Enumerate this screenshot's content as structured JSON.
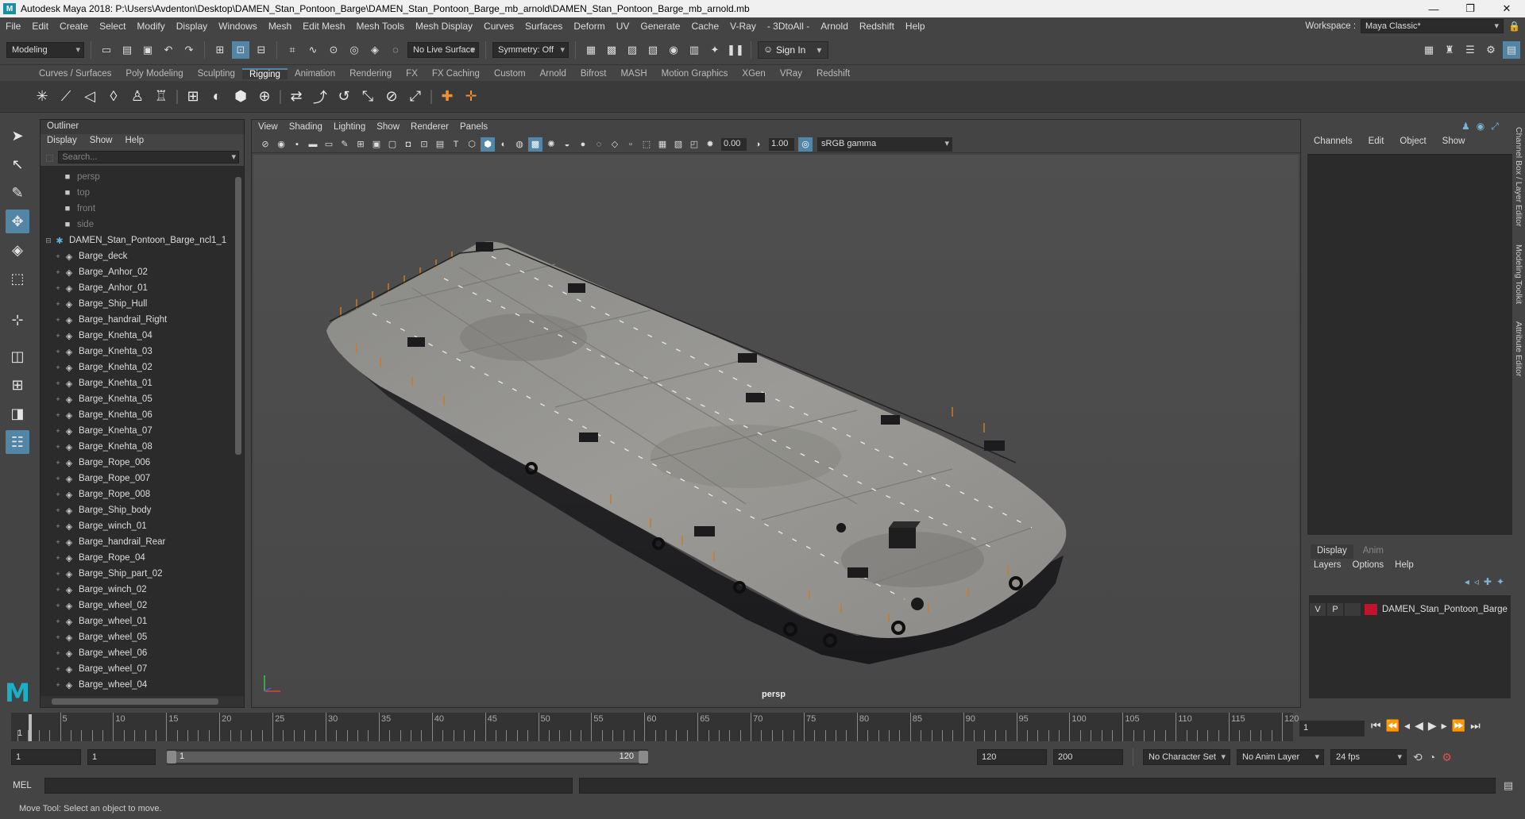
{
  "window": {
    "title": "Autodesk Maya 2018: P:\\Users\\Avdenton\\Desktop\\DAMEN_Stan_Pontoon_Barge\\DAMEN_Stan_Pontoon_Barge_mb_arnold\\DAMEN_Stan_Pontoon_Barge_mb_arnold.mb",
    "minimize": "—",
    "maximize": "❐",
    "close": "✕"
  },
  "menubar": {
    "items": [
      "File",
      "Edit",
      "Create",
      "Select",
      "Modify",
      "Display",
      "Windows",
      "Mesh",
      "Edit Mesh",
      "Mesh Tools",
      "Mesh Display",
      "Curves",
      "Surfaces",
      "Deform",
      "UV",
      "Generate",
      "Cache",
      "V-Ray",
      "- 3DtoAll -",
      "Arnold",
      "Redshift",
      "Help"
    ],
    "workspace_label": "Workspace :",
    "workspace_value": "Maya Classic*"
  },
  "statusline": {
    "menuset": "Modeling",
    "live_surface": "No Live Surface",
    "symmetry": "Symmetry: Off",
    "sign_in": "Sign In"
  },
  "shelf": {
    "tabs": [
      "Curves / Surfaces",
      "Poly Modeling",
      "Sculpting",
      "Rigging",
      "Animation",
      "Rendering",
      "FX",
      "FX Caching",
      "Custom",
      "Arnold",
      "Bifrost",
      "MASH",
      "Motion Graphics",
      "XGen",
      "VRay",
      "Redshift"
    ],
    "active_tab": "Rigging"
  },
  "outliner": {
    "title": "Outliner",
    "menu": [
      "Display",
      "Show",
      "Help"
    ],
    "search_placeholder": "Search...",
    "cameras": [
      "persp",
      "top",
      "front",
      "side"
    ],
    "group": "DAMEN_Stan_Pontoon_Barge_ncl1_1",
    "items": [
      "Barge_deck",
      "Barge_Anhor_02",
      "Barge_Anhor_01",
      "Barge_Ship_Hull",
      "Barge_handrail_Right",
      "Barge_Knehta_04",
      "Barge_Knehta_03",
      "Barge_Knehta_02",
      "Barge_Knehta_01",
      "Barge_Knehta_05",
      "Barge_Knehta_06",
      "Barge_Knehta_07",
      "Barge_Knehta_08",
      "Barge_Rope_006",
      "Barge_Rope_007",
      "Barge_Rope_008",
      "Barge_Ship_body",
      "Barge_winch_01",
      "Barge_handrail_Rear",
      "Barge_Rope_04",
      "Barge_Ship_part_02",
      "Barge_winch_02",
      "Barge_wheel_02",
      "Barge_wheel_01",
      "Barge_wheel_05",
      "Barge_wheel_06",
      "Barge_wheel_07",
      "Barge_wheel_04"
    ]
  },
  "viewport": {
    "menu": [
      "View",
      "Shading",
      "Lighting",
      "Show",
      "Renderer",
      "Panels"
    ],
    "exposure": "0.00",
    "gamma": "1.00",
    "color_space": "sRGB gamma",
    "camera": "persp"
  },
  "channelbox": {
    "menu": [
      "Channels",
      "Edit",
      "Object",
      "Show"
    ],
    "layer_tabs": [
      "Display",
      "Anim"
    ],
    "layer_menu": [
      "Layers",
      "Options",
      "Help"
    ],
    "layer": {
      "v": "V",
      "p": "P",
      "name": "DAMEN_Stan_Pontoon_Barge",
      "color": "#c0142c"
    },
    "side_tabs": [
      "Channel Box / Layer Editor",
      "Modeling Toolkit",
      "Attribute Editor"
    ]
  },
  "timeline": {
    "ticks": [
      "5",
      "10",
      "15",
      "20",
      "25",
      "30",
      "35",
      "40",
      "45",
      "50",
      "55",
      "60",
      "65",
      "70",
      "75",
      "80",
      "85",
      "90",
      "95",
      "100",
      "105",
      "110",
      "115",
      "120"
    ],
    "start_label": "1",
    "current_frame": "1"
  },
  "range": {
    "start": "1",
    "playback_start": "1",
    "slider_start": "1",
    "slider_end": "120",
    "playback_end": "120",
    "end": "200",
    "character_set": "No Character Set",
    "anim_layer": "No Anim Layer",
    "fps": "24 fps"
  },
  "cmdline": {
    "label": "MEL"
  },
  "helpline": {
    "text": "Move Tool: Select an object to move."
  }
}
